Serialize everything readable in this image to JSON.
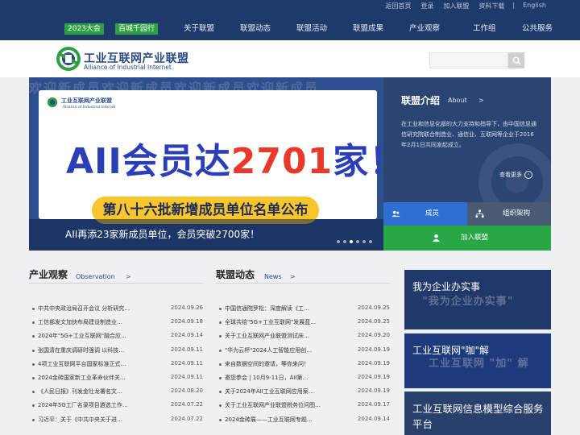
{
  "utility_links": [
    "返回首页",
    "登录",
    "加入联盟",
    "资料下载",
    "|",
    "English"
  ],
  "nav": {
    "badges": [
      "2023大会",
      "百城千园行"
    ],
    "items": [
      "关于联盟",
      "联盟动态",
      "联盟活动",
      "联盟成果",
      "产业观察",
      "工作组",
      "公共服务"
    ]
  },
  "logo": {
    "cn": "工业互联网产业联盟",
    "en": "Alliance of Industrial Internet"
  },
  "search": {
    "placeholder": ""
  },
  "hero": {
    "watermark": "欢迎新成员欢迎新成员欢迎新成员欢迎新成员",
    "card_logo_cn": "工业互联网产业联盟",
    "card_logo_en": "Alliance of Industrial Internet",
    "headline_pre": "AII会员达",
    "headline_num": "2701",
    "headline_post": "家！",
    "ribbon": "第八十六批新增成员单位名单公布",
    "caption": "AII再添23家新成员单位，会员突破2700家！",
    "active_slide": 3,
    "slide_count": 6
  },
  "intro": {
    "title": "联盟介绍",
    "title_en": "About",
    "arrow": ">",
    "text": "在工业和信息化部的大力支持和指导下，由中国信息通信研究院联合制造业、通信业、互联网等企业于2016年2月1日共同发起成立。",
    "more": "查看更多",
    "more_icon": "›"
  },
  "quick_buttons": {
    "members": "成员",
    "org": "组织架构",
    "join": "加入联盟"
  },
  "observation": {
    "title": "产业观察",
    "title_en": "Observation",
    "arrow": ">",
    "items": [
      {
        "title": "中共中央政治局召开会议 分析研究…",
        "date": "2024.09.26"
      },
      {
        "title": "工信部发文加快布局建设制造业…",
        "date": "2024.09.18"
      },
      {
        "title": "2024年\"5G+工业互联网\"融合应…",
        "date": "2024.09.14"
      },
      {
        "title": "张国清在重庆调研时强调 以科技…",
        "date": "2024.09.11"
      },
      {
        "title": "4项工业互联网平台国家标准正式…",
        "date": "2024.09.11"
      },
      {
        "title": "2024金砖国家新工业革命伙伴关…",
        "date": "2024.09.11"
      },
      {
        "title": "《人民日报》刊发金壮龙署名文…",
        "date": "2024.08.20"
      },
      {
        "title": "2024年5G工厂名录项目遴选工作…",
        "date": "2024.07.22"
      },
      {
        "title": "习近平：关于《中共中央关于进…",
        "date": "2024.07.22"
      }
    ]
  },
  "news": {
    "title": "联盟动态",
    "title_en": "News",
    "arrow": ">",
    "items": [
      {
        "title": "中国信通院罗松：深度解读《工…",
        "date": "2024.09.25"
      },
      {
        "title": "全球共绘\"5G+工业互联网\"发展蓝…",
        "date": "2024.09.25"
      },
      {
        "title": "关于工业互联网产业联盟测试床…",
        "date": "2024.09.20"
      },
      {
        "title": "\"华为云杯\"2024人工智能应用创…",
        "date": "2024.09.19"
      },
      {
        "title": "来自数据空间的邀请，等你来问！",
        "date": "2024.09.19"
      },
      {
        "title": "邀您参会 | 10月9-11日，AII第…",
        "date": "2024.09.19"
      },
      {
        "title": "关于2024年AII工业互联网应用案…",
        "date": "2024.09.19"
      },
      {
        "title": "关于工业互联网产业联盟税务位问图…",
        "date": "2024.09.17"
      },
      {
        "title": "2024金砖展——工业互联网专题…",
        "date": "2024.09.14"
      }
    ]
  },
  "promos": [
    {
      "title": "我为企业办实事",
      "watermark": "\"我为企业办实事\""
    },
    {
      "title": "工业互联网\"咖\"解",
      "watermark": "工业互联网 \"加\" 解"
    },
    {
      "title": "工业互联网信息模型综合服务平台"
    }
  ],
  "colors": {
    "topbar": "#1d3a6b",
    "accent_green": "#27a745",
    "accent_blue": "#2e6fd1",
    "headline_blue": "#2b3eb8",
    "headline_red": "#e8392b",
    "ribbon_yellow": "#f7c52c"
  }
}
